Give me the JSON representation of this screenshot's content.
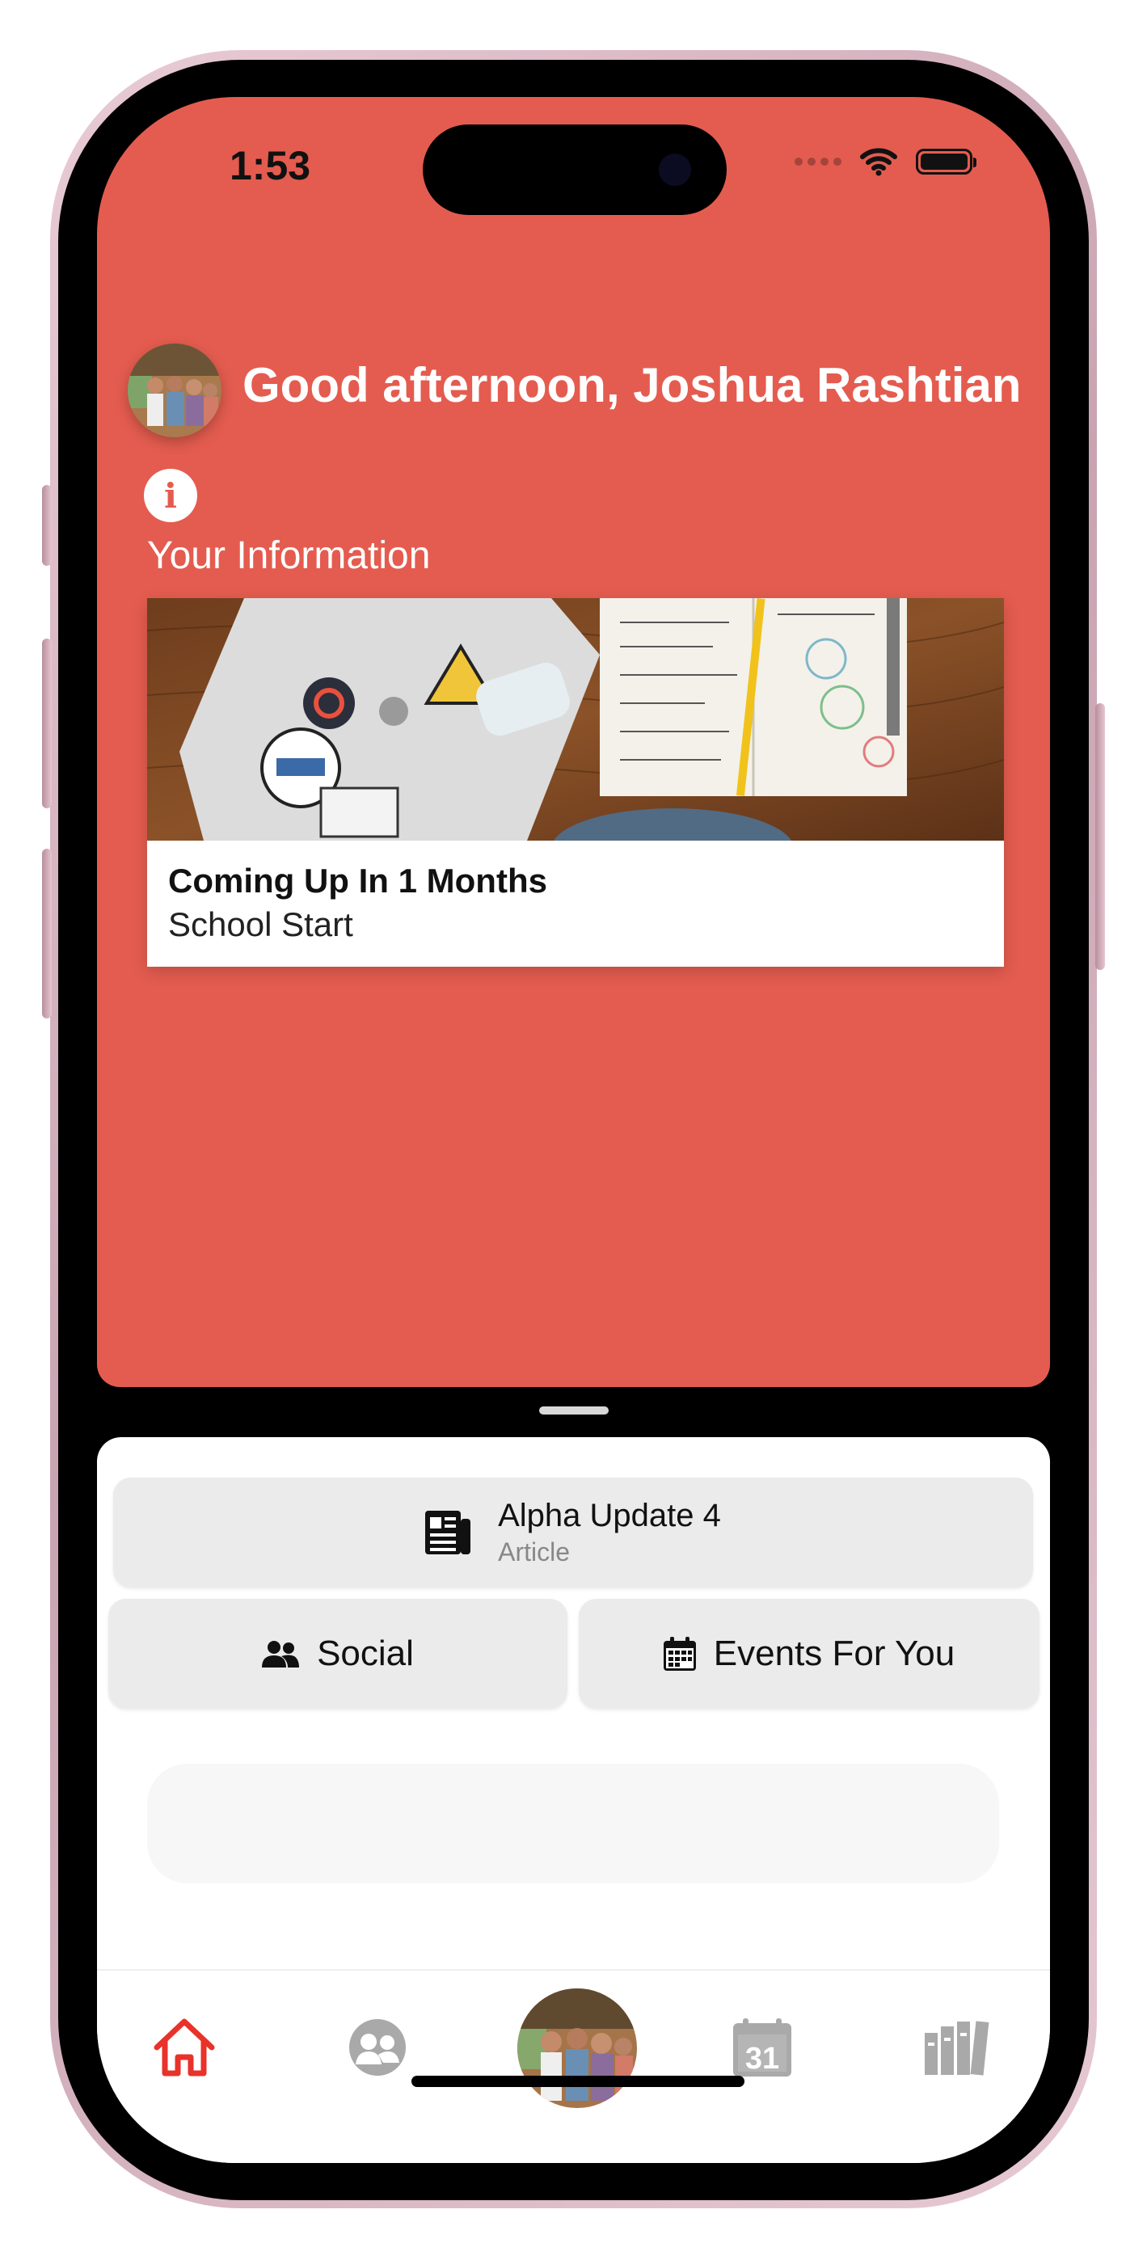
{
  "status_bar": {
    "time": "1:53"
  },
  "header": {
    "greeting": "Good afternoon, Joshua Rashtian"
  },
  "info_section": {
    "icon_glyph": "i",
    "label": "Your Information"
  },
  "event_card": {
    "title": "Coming Up In 1 Months",
    "subtitle": "School Start"
  },
  "quick_actions": {
    "article": {
      "title": "Alpha Update 4",
      "type": "Article",
      "icon": "newspaper-icon"
    },
    "social": {
      "label": "Social",
      "icon": "people-icon"
    },
    "events": {
      "label": "Events For You",
      "icon": "calendar-icon"
    }
  },
  "tab_bar": {
    "items": [
      "home",
      "social",
      "profile",
      "calendar",
      "library"
    ],
    "active": "home",
    "calendar_day": "31"
  },
  "colors": {
    "brand": "#e45c4f",
    "active_tab": "#e8322a",
    "inactive_tab": "#a9a9a9"
  }
}
